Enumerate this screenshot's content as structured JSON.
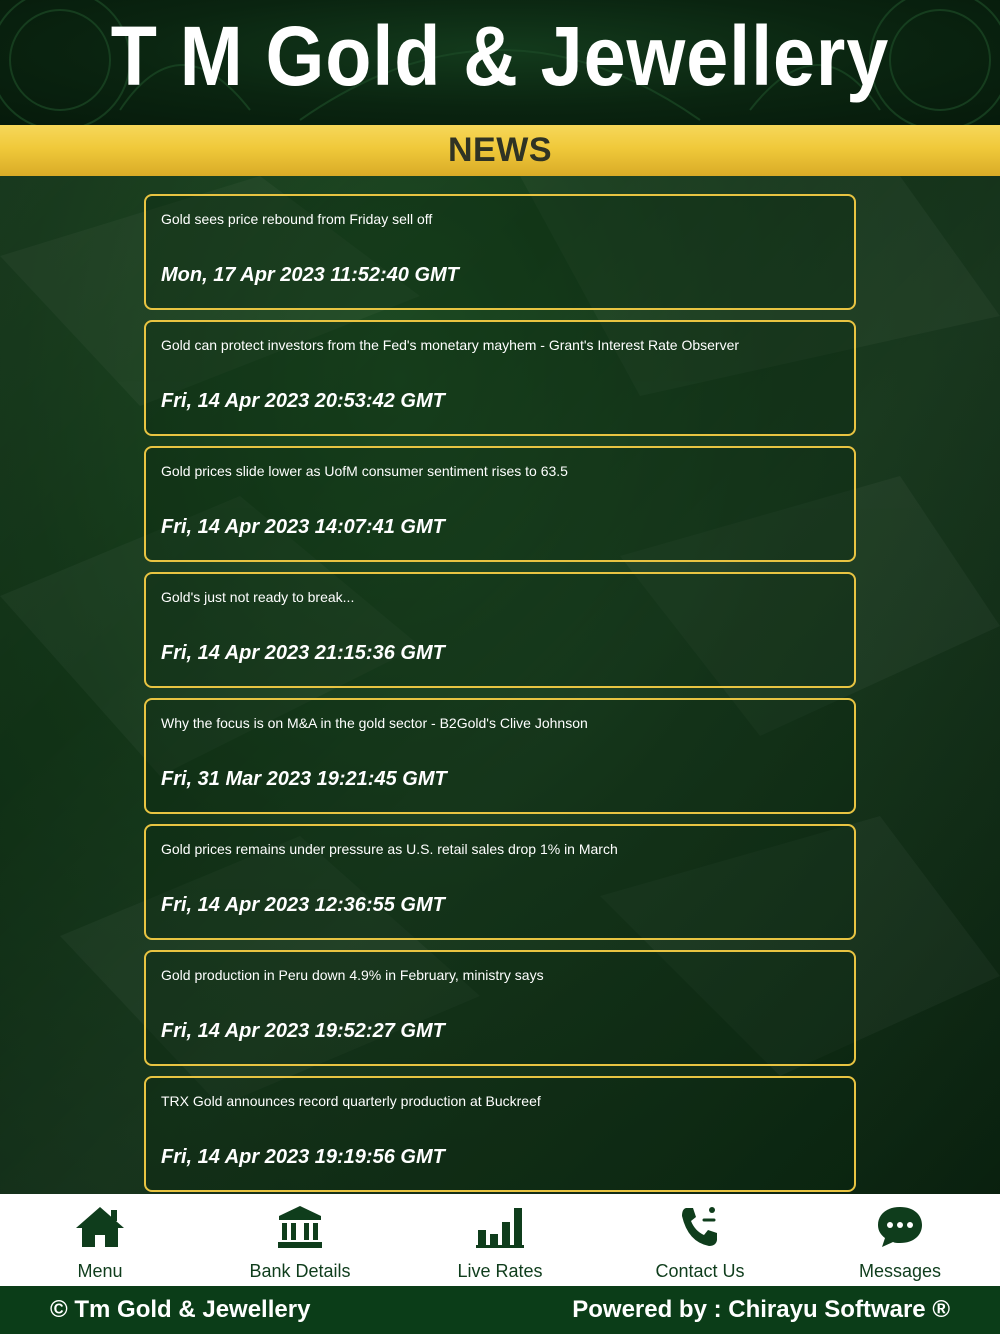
{
  "header": {
    "brand": "T M Gold & Jewellery"
  },
  "banner": {
    "title": "NEWS"
  },
  "news": [
    {
      "title": "Gold sees price rebound from Friday sell off",
      "date": "Mon, 17 Apr 2023 11:52:40 GMT"
    },
    {
      "title": "Gold can protect investors from the Fed's monetary mayhem - Grant's Interest Rate Observer",
      "date": "Fri, 14 Apr 2023 20:53:42 GMT"
    },
    {
      "title": "Gold prices slide lower as UofM consumer sentiment rises to 63.5",
      "date": "Fri, 14 Apr 2023 14:07:41 GMT"
    },
    {
      "title": "Gold's just not ready to break...",
      "date": "Fri, 14 Apr 2023 21:15:36 GMT"
    },
    {
      "title": "Why the focus is on M&A in the gold sector - B2Gold's Clive Johnson",
      "date": "Fri, 31 Mar 2023 19:21:45 GMT"
    },
    {
      "title": "Gold prices remains under pressure as U.S. retail sales drop 1% in March",
      "date": "Fri, 14 Apr 2023 12:36:55 GMT"
    },
    {
      "title": "Gold production in Peru down 4.9% in February, ministry says",
      "date": "Fri, 14 Apr 2023 19:52:27 GMT"
    },
    {
      "title": "TRX Gold announces record quarterly production at Buckreef",
      "date": "Fri, 14 Apr 2023 19:19:56 GMT"
    }
  ],
  "tabs": [
    {
      "label": "Menu",
      "icon": "home-icon"
    },
    {
      "label": "Bank Details",
      "icon": "bank-icon"
    },
    {
      "label": "Live Rates",
      "icon": "bar-chart-icon"
    },
    {
      "label": "Contact Us",
      "icon": "phone-icon"
    },
    {
      "label": "Messages",
      "icon": "chat-icon"
    }
  ],
  "footer": {
    "copyright": "© Tm Gold & Jewellery",
    "powered_by": "Powered by : Chirayu Software ®"
  },
  "colors": {
    "accent_gold": "#e8c442",
    "banner_gold": "#f0c93a",
    "dark_green": "#0b3d18",
    "icon_green": "#0f3d1c"
  }
}
